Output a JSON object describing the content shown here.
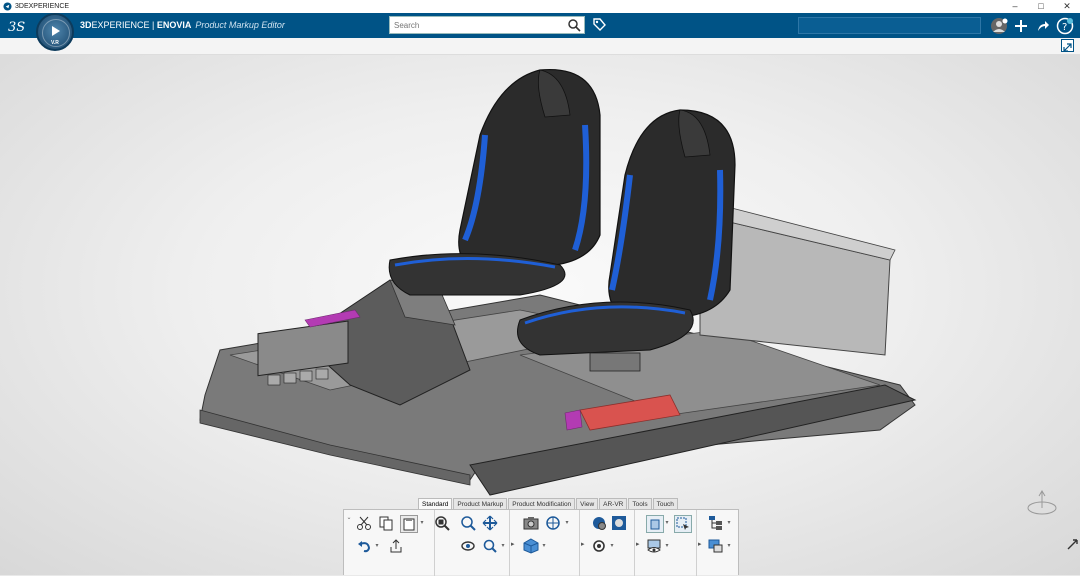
{
  "os_window": {
    "title": "3DEXPERIENCE",
    "controls": [
      "–",
      "□",
      "✕"
    ]
  },
  "top_bar": {
    "brand_bold": "3D",
    "brand_rest": "EXPERIENCE | ",
    "brand_product": "ENOVIA",
    "app_name": "Product Markup Editor",
    "compass_version": "V.R",
    "background_color": "#005386"
  },
  "search": {
    "placeholder": "Search",
    "icon": "search-icon"
  },
  "top_right_icons": [
    "avatar-icon",
    "plus-icon",
    "share-icon",
    "help-icon"
  ],
  "action_bar": {
    "tabs": [
      {
        "label": "Standard",
        "active": true
      },
      {
        "label": "Product Markup",
        "active": false
      },
      {
        "label": "Product Modification",
        "active": false
      },
      {
        "label": "View",
        "active": false
      },
      {
        "label": "AR-VR",
        "active": false
      },
      {
        "label": "Tools",
        "active": false
      },
      {
        "label": "Touch",
        "active": false
      }
    ],
    "groups": [
      {
        "name": "clipboard",
        "icons": [
          "cut-icon",
          "copy-icon",
          "paste-icon",
          "undo-icon",
          "export-icon"
        ]
      },
      {
        "name": "navigation",
        "icons": [
          "fit-all-icon",
          "zoom-icon",
          "pan-icon",
          "rotate-icon",
          "zoom-area-icon"
        ]
      },
      {
        "name": "capture",
        "icons": [
          "capture-icon",
          "view-options-icon",
          "view-cube-icon",
          "render-settings-icon"
        ]
      },
      {
        "name": "visualization",
        "icons": [
          "shading-icon",
          "ambience-icon"
        ]
      },
      {
        "name": "display",
        "icons": [
          "box-icon",
          "select-icon",
          "hide-show-icon"
        ]
      },
      {
        "name": "tree",
        "icons": [
          "tree-icon",
          "structure-icon"
        ]
      }
    ]
  },
  "colors": {
    "seat_accent": "#1f5fd6",
    "seat_body": "#2b2b2b",
    "chassis": "#6a6a6a",
    "highlight_red": "#d9534f",
    "highlight_magenta": "#b33bb3"
  }
}
